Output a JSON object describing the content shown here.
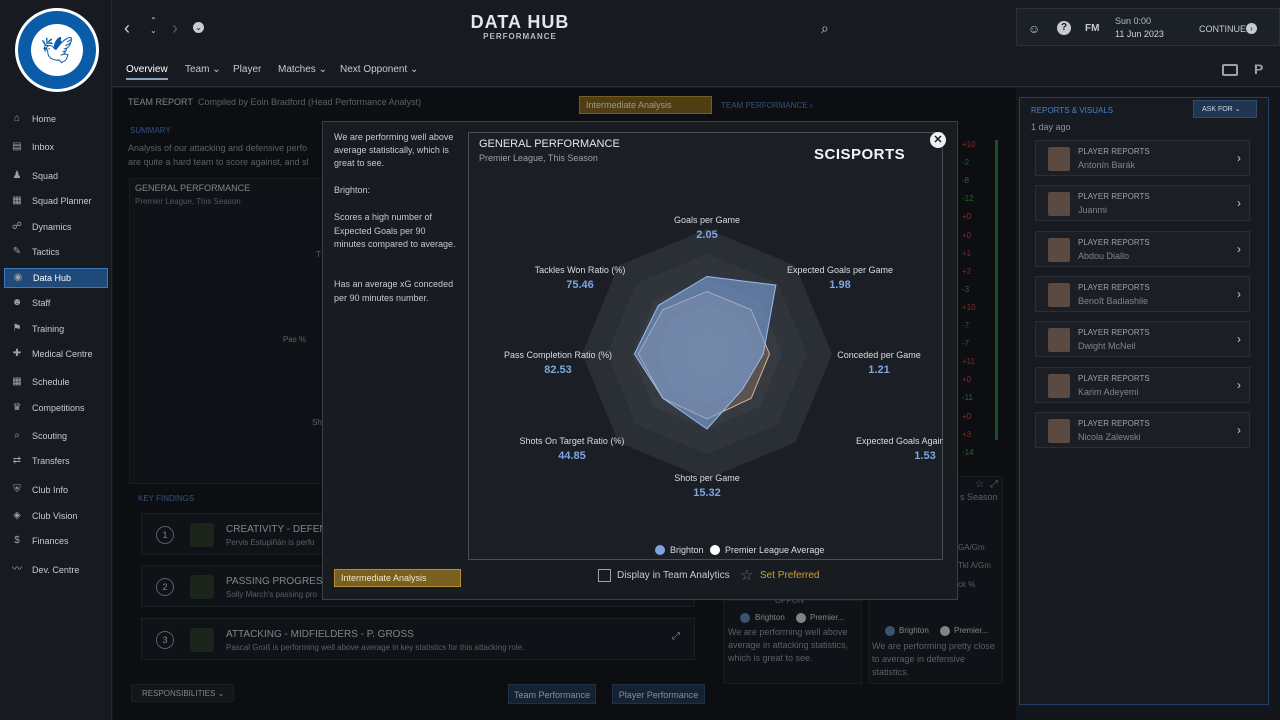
{
  "sidebar": {
    "items": [
      {
        "label": "Home",
        "icon": "home-icon"
      },
      {
        "label": "Inbox",
        "icon": "inbox-icon"
      },
      {
        "label": "Squad",
        "icon": "squad-icon"
      },
      {
        "label": "Squad Planner",
        "icon": "planner-icon"
      },
      {
        "label": "Dynamics",
        "icon": "dynamics-icon"
      },
      {
        "label": "Tactics",
        "icon": "tactics-icon"
      },
      {
        "label": "Data Hub",
        "icon": "datahub-icon"
      },
      {
        "label": "Staff",
        "icon": "staff-icon"
      },
      {
        "label": "Training",
        "icon": "training-icon"
      },
      {
        "label": "Medical Centre",
        "icon": "medical-icon"
      },
      {
        "label": "Schedule",
        "icon": "schedule-icon"
      },
      {
        "label": "Competitions",
        "icon": "trophy-icon"
      },
      {
        "label": "Scouting",
        "icon": "scouting-icon"
      },
      {
        "label": "Transfers",
        "icon": "transfers-icon"
      },
      {
        "label": "Club Info",
        "icon": "shield-icon"
      },
      {
        "label": "Club Vision",
        "icon": "vision-icon"
      },
      {
        "label": "Finances",
        "icon": "finances-icon"
      },
      {
        "label": "Dev. Centre",
        "icon": "dev-icon"
      }
    ],
    "crest_text": "BRIGHTON & HOVE ALBION"
  },
  "header": {
    "title": "DATA HUB",
    "subtitle": "PERFORMANCE",
    "date_day": "Sun 0:00",
    "date": "11 Jun 2023",
    "continue": "CONTINUE",
    "fm": "FM"
  },
  "subnav": [
    "Overview",
    "Team",
    "Player",
    "Matches",
    "Next Opponent"
  ],
  "report": {
    "label": "TEAM REPORT",
    "compiled": "Compiled by Eoin Bradford (Head Performance Analyst)",
    "analysis_btn": "Intermediate Analysis",
    "team_perf_link": "TEAM PERFORMANCE ›",
    "summary_label": "SUMMARY",
    "summary_text_1": "Analysis of our attacking and defensive perfo",
    "summary_text_2": "are quite a hard team to score against, and sl",
    "gp_title": "GENERAL PERFORMANCE",
    "gp_sub": "Premier League, This Season",
    "bg_label_1": "Pas %",
    "bg_label_2": "Sh",
    "bg_label_3": "T"
  },
  "key_findings": {
    "label": "KEY FINDINGS",
    "items": [
      {
        "num": "1",
        "title": "CREATIVITY - DEFENDE",
        "desc": "Pervis Estupiñán is perfo"
      },
      {
        "num": "2",
        "title": "PASSING PROGRESSIC",
        "desc": "Solly March's passing pro"
      },
      {
        "num": "3",
        "title": "ATTACKING - MIDFIELDERS - P. GROSS",
        "desc": "Pascal Groß is performing well above average in key statistics for this attacking role."
      }
    ]
  },
  "bottom": {
    "responsibilities": "RESPONSIBILITIES",
    "team_perf_btn": "Team Performance",
    "player_perf_btn": "Player Performance"
  },
  "diffs": [
    "+10",
    "-2",
    "-8",
    "-12",
    "+0",
    "+0",
    "+1",
    "+2",
    "-3",
    "+10",
    "-7",
    "-7",
    "+11",
    "+0",
    "-11",
    "+0",
    "+3",
    "-14"
  ],
  "sidecards": {
    "c1_fragment": "s Season",
    "c1_stats": [
      "GA/Gm",
      "Tkl A/Gm",
      "ck %"
    ],
    "c1_legend_a": "Brighton",
    "c1_legend_b": "Premier...",
    "c1_text": "We are performing well above average in attacking statistics, which is great to see.",
    "c1_partial": "OPPON",
    "c2_legend_a": "Brighton",
    "c2_legend_b": "Premier...",
    "c2_text": "We are performing pretty close to average in defensive statistics."
  },
  "reports": {
    "label": "REPORTS & VISUALS",
    "ask_for": "ASK FOR",
    "ago": "1 day ago",
    "items": [
      {
        "type": "PLAYER REPORTS",
        "name": "Antonín Barák"
      },
      {
        "type": "PLAYER REPORTS",
        "name": "Juanmi"
      },
      {
        "type": "PLAYER REPORTS",
        "name": "Abdou Diallo"
      },
      {
        "type": "PLAYER REPORTS",
        "name": "Benoît Badiashile"
      },
      {
        "type": "PLAYER REPORTS",
        "name": "Dwight McNeil"
      },
      {
        "type": "PLAYER REPORTS",
        "name": "Karim Adeyemi"
      },
      {
        "type": "PLAYER REPORTS",
        "name": "Nicola Zalewski"
      }
    ]
  },
  "modal": {
    "text_1": "We are performing well above average statistically, which is great to see.",
    "text_2": "Brighton:",
    "text_3": "Scores a high number of Expected Goals per 90 minutes compared to average.",
    "text_4": "Has an average xG conceded per 90 minutes number.",
    "analysis_btn": "Intermediate Analysis",
    "display_label": "Display in Team Analytics",
    "set_preferred": "Set Preferred",
    "brand": "SCISPORTS"
  },
  "chart_data": {
    "type": "radar",
    "title": "GENERAL PERFORMANCE",
    "subtitle": "Premier League, This Season",
    "axes": [
      {
        "label": "Goals per Game",
        "value": "2.05",
        "brighton": 0.62,
        "avg": 0.5
      },
      {
        "label": "Expected Goals per Game",
        "value": "1.98",
        "brighton": 0.78,
        "avg": 0.5
      },
      {
        "label": "Conceded per Game",
        "value": "1.21",
        "brighton": 0.45,
        "avg": 0.5
      },
      {
        "label": "Expected Goals Against per Game",
        "value": "1.53",
        "brighton": 0.4,
        "avg": 0.5
      },
      {
        "label": "Shots per Game",
        "value": "15.32",
        "brighton": 0.6,
        "avg": 0.52
      },
      {
        "label": "Shots On Target Ratio (%)",
        "value": "44.85",
        "brighton": 0.5,
        "avg": 0.5
      },
      {
        "label": "Pass Completion Ratio (%)",
        "value": "82.53",
        "brighton": 0.58,
        "avg": 0.55
      },
      {
        "label": "Tackles Won Ratio (%)",
        "value": "75.46",
        "brighton": 0.55,
        "avg": 0.5
      }
    ],
    "series": [
      {
        "name": "Brighton",
        "color": "#7da5e0"
      },
      {
        "name": "Premier League Average",
        "color": "#ffffff"
      }
    ]
  }
}
